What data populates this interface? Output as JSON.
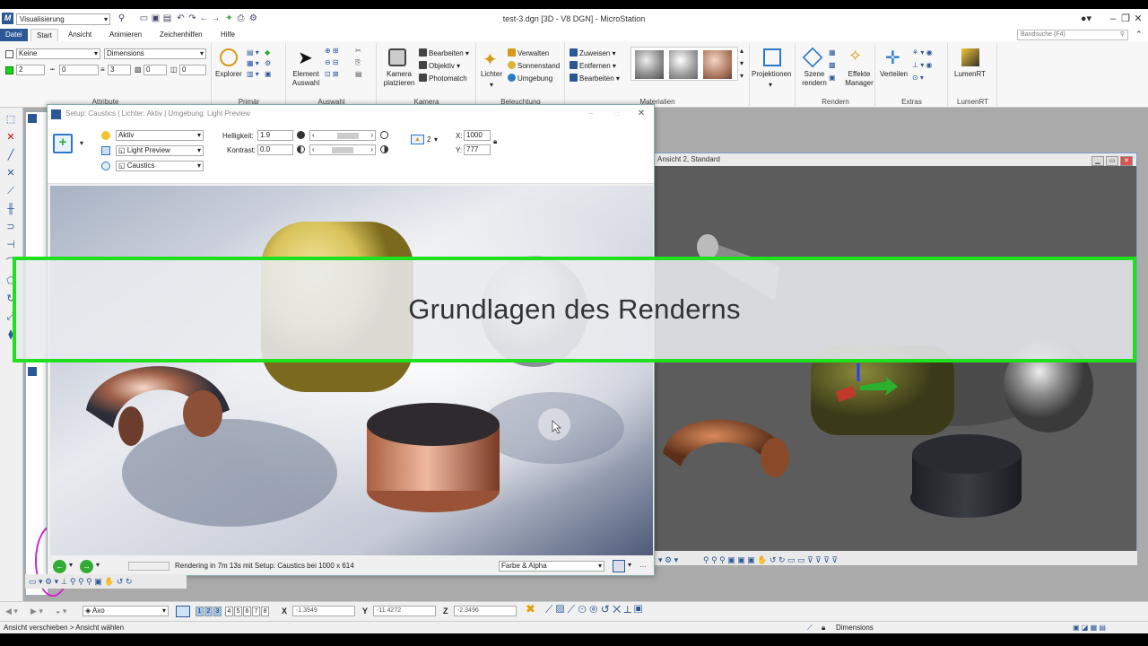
{
  "app": {
    "window_title": "test-3.dgn [3D - V8 DGN] - MicroStation",
    "workflow": "Visualisierung",
    "band_search_placeholder": "Bandsuche (F4)"
  },
  "menu_tabs": [
    "Datei",
    "Start",
    "Ansicht",
    "Animieren",
    "Zeichenhilfen",
    "Hilfe"
  ],
  "ribbon": {
    "attribute": {
      "level": "Keine",
      "style": "Dimensions",
      "color": "2",
      "weight_a": "0",
      "weight_b": "3",
      "transparency": "0",
      "priority": "0",
      "label": "Attribute"
    },
    "primaer": {
      "explorer": "Explorer",
      "label": "Primär"
    },
    "auswahl": {
      "element_auswahl": "Element Auswahl",
      "label": "Auswahl"
    },
    "kamera": {
      "kamera_platzieren": "Kamera platzieren",
      "bearbeiten": "Bearbeiten",
      "objektiv": "Objektiv",
      "photomatch": "Photomatch",
      "label": "Kamera"
    },
    "beleuchtung": {
      "lichter": "Lichter",
      "verwalten": "Verwalten",
      "sonnenstand": "Sonnenstand",
      "umgebung": "Umgebung",
      "label": "Beleuchtung"
    },
    "materialien": {
      "zuweisen": "Zuweisen",
      "entfernen": "Entfernen",
      "bearbeiten": "Bearbeiten",
      "label": "Materialien"
    },
    "projektionen": "Projektionen",
    "rendern": {
      "szene_rendern": "Szene rendern",
      "effekte_manager": "Effekte Manager",
      "label": "Rendern"
    },
    "extras": {
      "verteilen": "Verteilen",
      "label": "Extras"
    },
    "lumenrt": {
      "button": "LumenRT",
      "label": "LumenRT"
    }
  },
  "render_dialog": {
    "title": "Setup: Caustics | Lichter: Aktiv | Umgebung: Light Preview",
    "lights": "Aktiv",
    "environment": "Light Preview",
    "setup": "Caustics",
    "helligkeit_label": "Helligkeit:",
    "helligkeit": "1.9",
    "kontrast_label": "Kontrast:",
    "kontrast": "0.0",
    "x_label": "X:",
    "x_value": "1000",
    "y_label": "Y:",
    "y_value": "777",
    "count": "2",
    "status_text": "Rendering in 7m 13s mit Setup: Caustics bei 1000 x 614",
    "output_mode": "Farbe & Alpha"
  },
  "view2": {
    "title": "Ansicht 2, Standard"
  },
  "banner": {
    "text": "Grundlagen des Renderns"
  },
  "bottom": {
    "view_mode": "Axo",
    "view_numbers": [
      "1",
      "2",
      "3",
      "4",
      "5",
      "6",
      "7",
      "8"
    ],
    "x_label": "X",
    "x": "-1.3949",
    "y_label": "Y",
    "y": "-11.4272",
    "z_label": "Z",
    "z": "-2.3496"
  },
  "status": {
    "prompt": "Ansicht verschieben > Ansicht wählen",
    "level": "Dimensions"
  },
  "colors": {
    "accent": "#2b5797",
    "banner_border": "#1fe01f",
    "view_bg": "#5e5e5e"
  }
}
